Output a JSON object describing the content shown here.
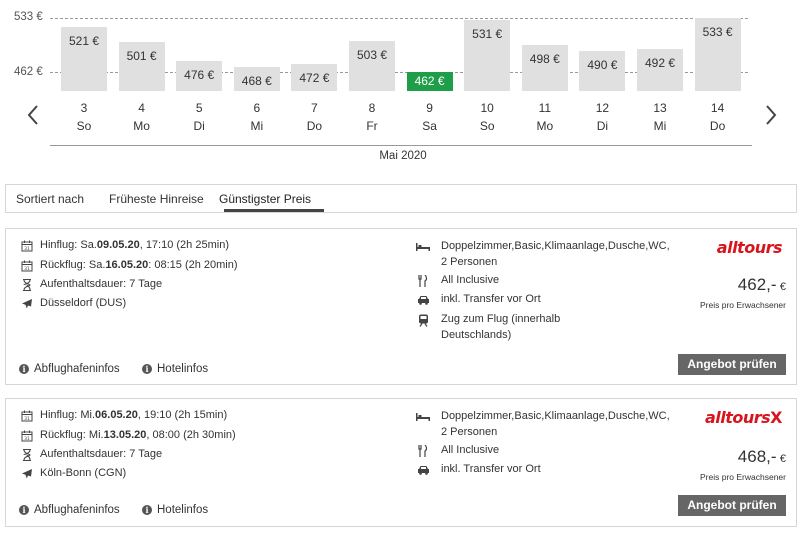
{
  "price_calendar": {
    "y_ticks": [
      "533 €",
      "462 €"
    ],
    "month": "Mai 2020",
    "days": [
      {
        "day": "3",
        "weekday": "So",
        "price": "521 €",
        "value": 521
      },
      {
        "day": "4",
        "weekday": "Mo",
        "price": "501 €",
        "value": 501
      },
      {
        "day": "5",
        "weekday": "Di",
        "price": "476 €",
        "value": 476
      },
      {
        "day": "6",
        "weekday": "Mi",
        "price": "468 €",
        "value": 468
      },
      {
        "day": "7",
        "weekday": "Do",
        "price": "472 €",
        "value": 472
      },
      {
        "day": "8",
        "weekday": "Fr",
        "price": "503 €",
        "value": 503
      },
      {
        "day": "9",
        "weekday": "Sa",
        "price": "462 €",
        "value": 462,
        "selected": true
      },
      {
        "day": "10",
        "weekday": "So",
        "price": "531 €",
        "value": 531
      },
      {
        "day": "11",
        "weekday": "Mo",
        "price": "498 €",
        "value": 498
      },
      {
        "day": "12",
        "weekday": "Di",
        "price": "490 €",
        "value": 490
      },
      {
        "day": "13",
        "weekday": "Mi",
        "price": "492 €",
        "value": 492
      },
      {
        "day": "14",
        "weekday": "Do",
        "price": "533 €",
        "value": 533
      }
    ],
    "colors": {
      "bar": "#e0e0e0",
      "selected_bar": "#1f9e4a"
    }
  },
  "sort": {
    "label": "Sortiert nach",
    "options": [
      "Früheste Hinreise",
      "Günstigster Preis"
    ],
    "active": "Günstigster Preis"
  },
  "offers": [
    {
      "outbound": {
        "label": "Hinflug: Sa. ",
        "date": "09.05.20",
        "time": ", 17:10 (2h 25min)"
      },
      "return": {
        "label": "Rückflug: Sa. ",
        "date": "16.05.20",
        "time": ": 08:15 (2h 20min)"
      },
      "stay": "Aufenthaltsdauer: 7 Tage",
      "airport": "Düsseldorf (DUS)",
      "room": "Doppelzimmer,Basic,Klimaanlage,Dusche,WC,\n2 Personen",
      "board": "All Inclusive",
      "transfer": "inkl. Transfer vor Ort",
      "train": "Zug zum Flug (innerhalb\nDeutschlands)",
      "operator": "alltours",
      "price": "462,-",
      "currency": "€",
      "price_note": "Preis pro Erwachsener",
      "cta": "Angebot prüfen",
      "airport_info": "Abflughafeninfos",
      "hotel_info": "Hotelinfos"
    },
    {
      "outbound": {
        "label": "Hinflug: Mi. ",
        "date": "06.05.20",
        "time": ", 19:10 (2h 15min)"
      },
      "return": {
        "label": "Rückflug: Mi. ",
        "date": "13.05.20",
        "time": ", 08:00 (2h 30min)"
      },
      "stay": "Aufenthaltsdauer: 7 Tage",
      "airport": "Köln-Bonn (CGN)",
      "room": "Doppelzimmer,Basic,Klimaanlage,Dusche,WC,\n2 Personen",
      "board": "All Inclusive",
      "transfer": "inkl. Transfer vor Ort",
      "operator": "alltours",
      "operator_mark": "X",
      "price": "468,-",
      "currency": "€",
      "price_note": "Preis pro Erwachsener",
      "cta": "Angebot prüfen",
      "airport_info": "Abflughafeninfos",
      "hotel_info": "Hotelinfos"
    }
  ]
}
